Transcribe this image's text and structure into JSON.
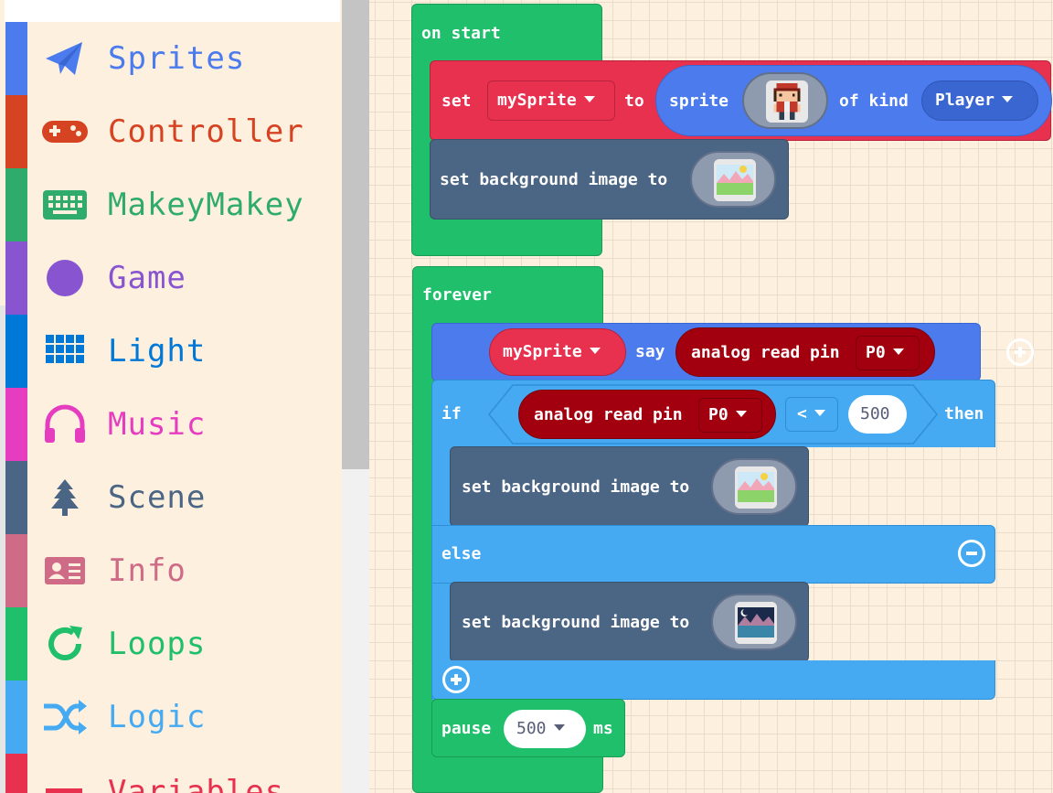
{
  "toolbox": {
    "categories": [
      {
        "label": "Sprites",
        "color": "#4b7bec",
        "icon": "paper-plane-icon"
      },
      {
        "label": "Controller",
        "color": "#d54322",
        "icon": "gamepad-icon"
      },
      {
        "label": "MakeyMakey",
        "color": "#2fac6c",
        "icon": "keyboard-icon"
      },
      {
        "label": "Game",
        "color": "#8854d0",
        "icon": "circle-icon"
      },
      {
        "label": "Light",
        "color": "#0078d7",
        "icon": "grid-icon"
      },
      {
        "label": "Music",
        "color": "#e63cc0",
        "icon": "headphones-icon"
      },
      {
        "label": "Scene",
        "color": "#4b6584",
        "icon": "tree-icon"
      },
      {
        "label": "Info",
        "color": "#cf6a87",
        "icon": "id-card-icon"
      },
      {
        "label": "Loops",
        "color": "#20bf6b",
        "icon": "refresh-icon"
      },
      {
        "label": "Logic",
        "color": "#45aaf2",
        "icon": "shuffle-icon"
      },
      {
        "label": "Variables",
        "color": "#e8304f",
        "icon": "list-icon"
      }
    ]
  },
  "workspace": {
    "on_start": {
      "label": "on start",
      "set_sprite": {
        "set_label": "set",
        "variable": "mySprite",
        "to_label": "to",
        "sprite_label": "sprite",
        "of_kind_label": "of kind",
        "kind": "Player"
      },
      "set_background": {
        "label": "set background image to"
      }
    },
    "forever": {
      "label": "forever",
      "say": {
        "variable": "mySprite",
        "say_label": "say",
        "analog_label": "analog read pin",
        "pin": "P0"
      },
      "if_block": {
        "if_label": "if",
        "analog_label": "analog read pin",
        "pin": "P0",
        "operator": "<",
        "value": "500",
        "then_label": "then",
        "then_action": "set background image to",
        "else_label": "else",
        "else_action": "set background image to"
      },
      "pause": {
        "label": "pause",
        "value": "500",
        "unit": "ms"
      }
    }
  },
  "colors": {
    "loops_green": "#20bf6b",
    "sprites_blue": "#4b7bec",
    "variables_red": "#e8304f",
    "scene_slate": "#4b6584",
    "logic_blue": "#45aaf2",
    "pins_darkred": "#a3000f"
  }
}
